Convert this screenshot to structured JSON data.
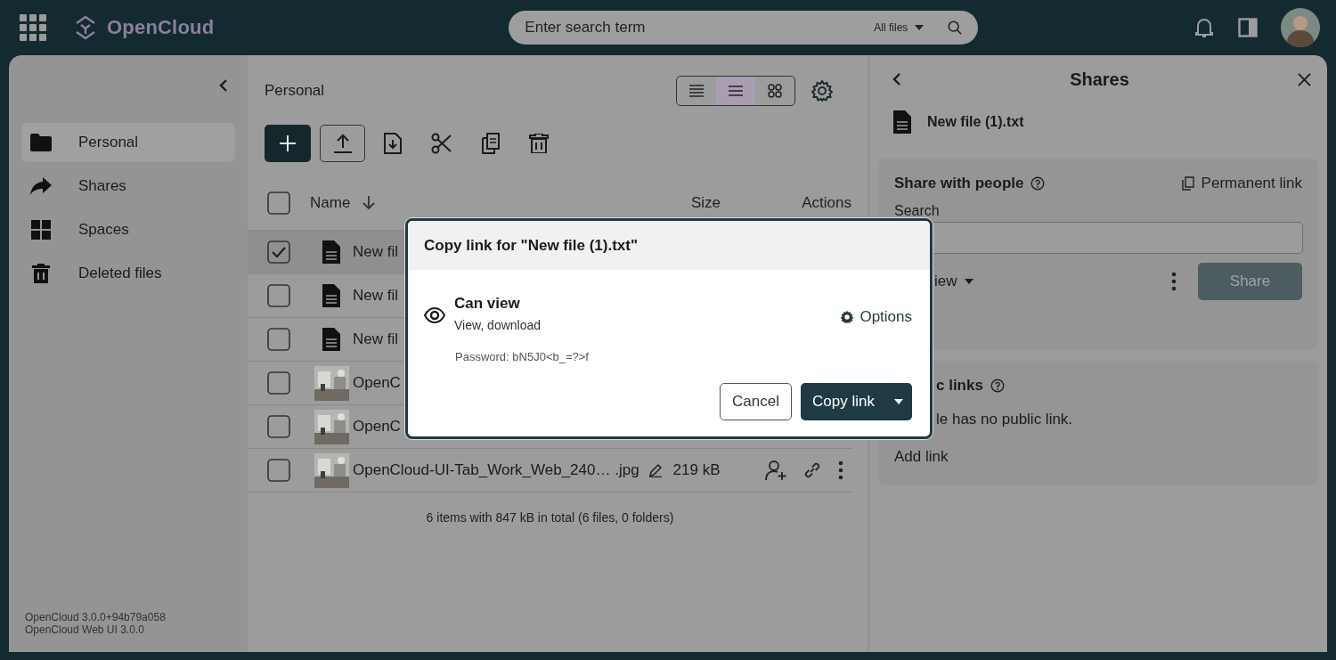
{
  "topbar": {
    "logo": "OpenCloud",
    "search": {
      "placeholder": "Enter search term",
      "scope": "All files"
    }
  },
  "sidebar": {
    "items": [
      {
        "label": "Personal",
        "kind": "folder",
        "selected": true
      },
      {
        "label": "Shares",
        "kind": "share",
        "selected": false
      },
      {
        "label": "Spaces",
        "kind": "spaces",
        "selected": false
      },
      {
        "label": "Deleted files",
        "kind": "trash",
        "selected": false
      }
    ],
    "version_lines": [
      "OpenCloud 3.0.0+94b79a058",
      "OpenCloud Web UI 3.0.0"
    ]
  },
  "files": {
    "breadcrumb": "Personal",
    "view_modes": [
      {
        "kind": "condensed",
        "selected": false
      },
      {
        "kind": "default",
        "selected": true
      },
      {
        "kind": "tiles",
        "selected": false
      }
    ],
    "select_all_checked": false,
    "columns": [
      "Name",
      "Size",
      "Actions"
    ],
    "rows": [
      {
        "name": "New fil",
        "kind": "text",
        "selected": true
      },
      {
        "name": "New fil",
        "kind": "text",
        "selected": false
      },
      {
        "name": "New fil",
        "kind": "text",
        "selected": false
      },
      {
        "name": "OpenC",
        "selected": false
      },
      {
        "name": "OpenC",
        "selected": false
      },
      {
        "name": "OpenCloud-UI-Tab_Work_Web_240… .jpg",
        "selected": false,
        "size": "219 kB"
      }
    ],
    "footer": "6 items with 847 kB in total (6 files, 0 folders)"
  },
  "shares": {
    "title": "Shares",
    "file": "New file (1).txt",
    "people": {
      "title": "Share with people",
      "permanent_link": "Permanent link",
      "search_label": "Search",
      "role": "iew",
      "share_button": "Share"
    },
    "public_links": {
      "title": "c links",
      "empty": "le has no public link.",
      "add": "Add link"
    }
  },
  "modal": {
    "title": "Copy link for \"New file (1).txt\"",
    "role": "Can view",
    "role_description": "View, download",
    "options": "Options",
    "password": "Password: bN5J0<b_=?>f",
    "cancel": "Cancel",
    "confirm": "Copy link"
  }
}
